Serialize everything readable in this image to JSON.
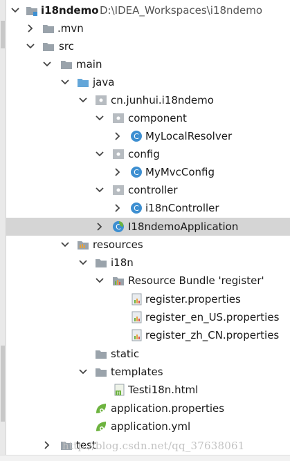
{
  "project": {
    "name": "i18ndemo",
    "path": "D:\\IDEA_Workspaces\\i18ndemo"
  },
  "tree": {
    "mvn": ".mvn",
    "src": "src",
    "main": "main",
    "java": "java",
    "package": "cn.junhui.i18ndemo",
    "component": "component",
    "my_local_resolver": "MyLocalResolver",
    "config": "config",
    "my_mvc_config": "MyMvcConfig",
    "controller": "controller",
    "i18n_controller": "i18nController",
    "application_class": "I18ndemoApplication",
    "resources": "resources",
    "i18n": "i18n",
    "resource_bundle": "Resource Bundle 'register'",
    "register_properties": "register.properties",
    "register_en_us": "register_en_US.properties",
    "register_zh_cn": "register_zh_CN.properties",
    "static": "static",
    "templates": "templates",
    "testi18n_html": "Testi18n.html",
    "application_properties": "application.properties",
    "application_yml": "application.yml",
    "test": "test"
  },
  "watermark": "http://blog.csdn.net/qq_37638061",
  "colors": {
    "selection": "#d5d5d5",
    "folder": "#9aa3ab",
    "source_folder": "#63a6d9",
    "class_badge": "#3d8fd1",
    "spring_leaf": "#6db33f"
  }
}
